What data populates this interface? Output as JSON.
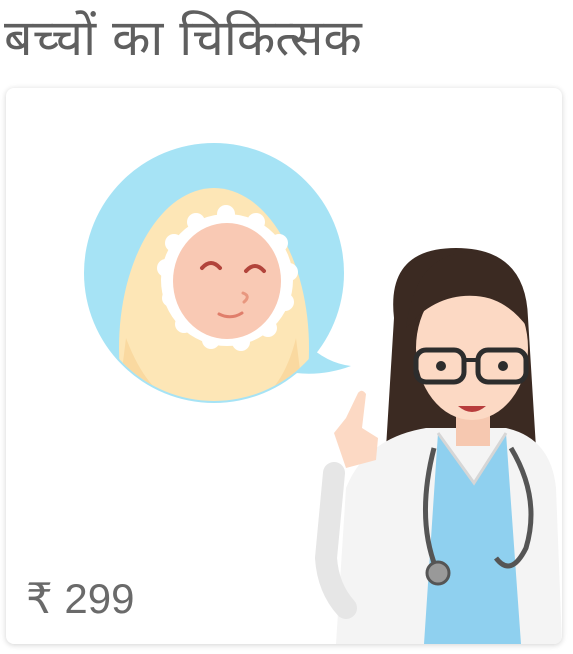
{
  "category": {
    "title": "बच्चों का चिकित्सक",
    "price": "₹ 299",
    "illustration": {
      "icon": "baby-doctor-illustration",
      "bubble_color": "#a6e3f5",
      "scrub_color": "#8fd0ef"
    }
  }
}
